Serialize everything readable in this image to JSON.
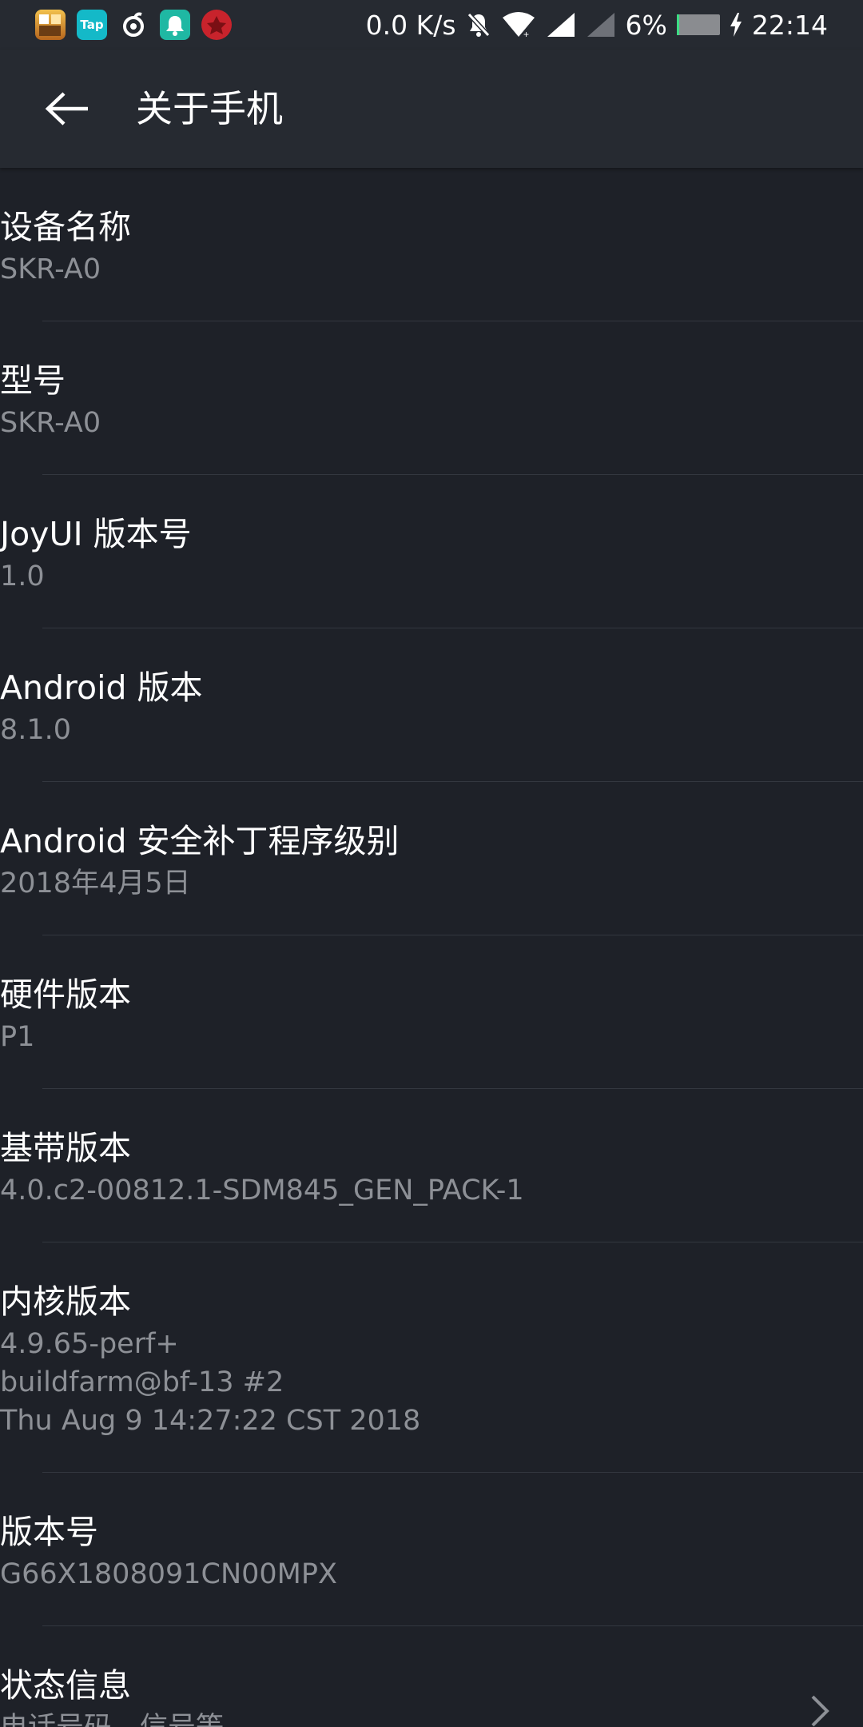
{
  "status_bar": {
    "app_icons": [
      "game-avatar-icon",
      "taptap-icon",
      "netease-music-icon",
      "notification-icon",
      "game-app-icon"
    ],
    "tap_label": "Tap",
    "speed": "0.0 K/s",
    "battery_percent": "6%",
    "battery_level": 0.06,
    "time": "22:14"
  },
  "toolbar": {
    "title": "关于手机"
  },
  "items": [
    {
      "title": "设备名称",
      "value": "SKR-A0"
    },
    {
      "title": "型号",
      "value": "SKR-A0"
    },
    {
      "title": "JoyUI 版本号",
      "value": "1.0"
    },
    {
      "title": "Android 版本",
      "value": "8.1.0"
    },
    {
      "title": "Android 安全补丁程序级别",
      "value": "2018年4月5日"
    },
    {
      "title": "硬件版本",
      "value": "P1"
    },
    {
      "title": "基带版本",
      "value": "4.0.c2-00812.1-SDM845_GEN_PACK-1"
    },
    {
      "title": "内核版本",
      "value_lines": [
        "4.9.65-perf+",
        "buildfarm@bf-13 #2",
        "Thu Aug 9 14:27:22 CST 2018"
      ]
    },
    {
      "title": "版本号",
      "value": "G66X1808091CN00MPX"
    },
    {
      "title": "状态信息",
      "value": "电话号码、信号等"
    }
  ],
  "colors": {
    "background": "#1e2128",
    "toolbar": "#262a31",
    "primary_text": "#ffffff",
    "secondary_text": "#8d9096",
    "divider": "#33373f",
    "battery_accent": "#3ddc84"
  }
}
